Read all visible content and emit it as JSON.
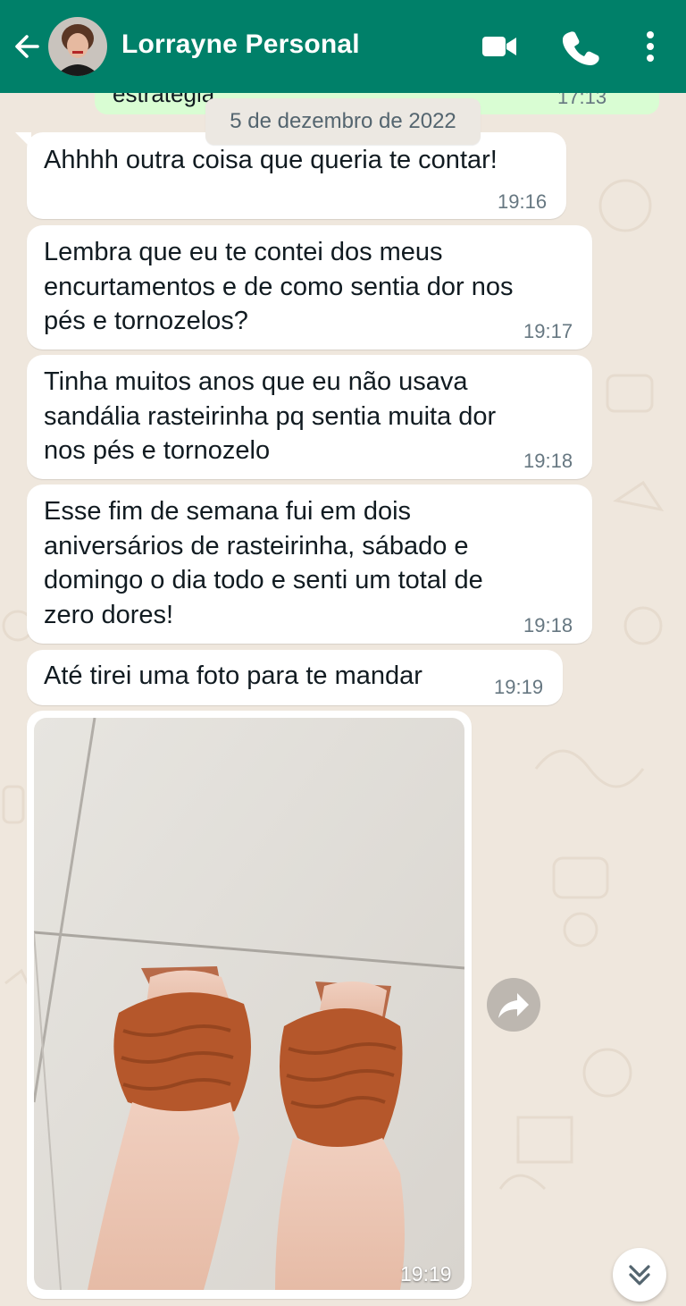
{
  "header": {
    "contact_name": "Lorrayne Personal",
    "icons": [
      "back-arrow-icon",
      "video-call-icon",
      "phone-call-icon",
      "more-vert-icon"
    ],
    "color": "#008069"
  },
  "previous_message": {
    "text": "estratégia",
    "time": "17:13"
  },
  "date_separator": "5 de dezembro de 2022",
  "messages": [
    {
      "lines": [
        "Ahhhh outra coisa que queria te contar!"
      ],
      "time": "19:16"
    },
    {
      "lines": [
        "Lembra que eu te contei dos meus",
        "encurtamentos e de como sentia dor nos",
        "pés e tornozelos?"
      ],
      "time": "19:17"
    },
    {
      "lines": [
        "Tinha muitos anos que eu não usava",
        "sandália rasteirinha pq sentia muita dor",
        "nos pés e tornozelo"
      ],
      "time": "19:18"
    },
    {
      "lines": [
        "Esse fim de semana fui em dois",
        "aniversários de rasteirinha, sábado e",
        "domingo o dia todo e senti um total de",
        "zero dores!"
      ],
      "time": "19:18"
    },
    {
      "lines": [
        "Até tirei uma foto para te mandar"
      ],
      "time": "19:19"
    }
  ],
  "photo_message": {
    "time": "19:19",
    "subject": "feet-in-sandals-photo"
  },
  "colors": {
    "incoming_bubble": "#ffffff",
    "outgoing_bubble": "#d9fdd3",
    "chat_background": "#efe7dd",
    "timestamp": "#667781"
  }
}
